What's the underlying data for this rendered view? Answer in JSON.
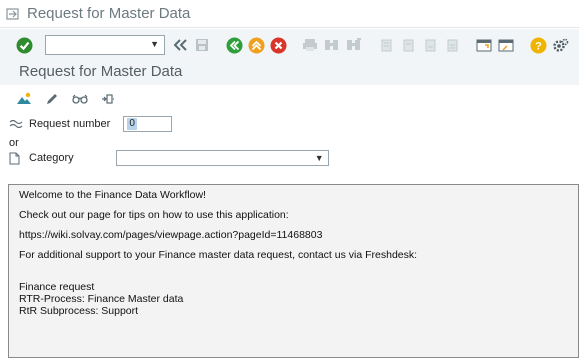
{
  "window": {
    "title": "Request for Master Data"
  },
  "toolbar": {
    "command_field": {
      "value": ""
    },
    "icons": [
      "enter-icon",
      "back-icon",
      "save-icon",
      "back-green-icon",
      "exit-icon",
      "cancel-icon",
      "print-icon",
      "find-icon",
      "find-next-icon",
      "first-page-icon",
      "previous-page-icon",
      "next-page-icon",
      "last-page-icon",
      "create-session-icon",
      "shortcut-icon",
      "help-icon",
      "settings-icon"
    ]
  },
  "app": {
    "title": "Request for Master Data",
    "toolbar_icons": [
      "create-icon",
      "edit-icon",
      "display-icon",
      "execute-icon"
    ]
  },
  "form": {
    "request_number_label": "Request number",
    "request_number_value": "0",
    "or_label": "or",
    "category_label": "Category",
    "category_value": ""
  },
  "message": {
    "lines": [
      "Welcome to the Finance Data Workflow!",
      "Check out our page for tips on how to use this application:",
      "https://wiki.solvay.com/pages/viewpage.action?pageId=11468803",
      "For additional support to your Finance master data request, contact us via Freshdesk:",
      "Finance request",
      "RTR-Process: Finance Master data",
      "RtR Subprocess: Support"
    ]
  },
  "colors": {
    "enter": "#2e8b2e",
    "nav_orange": "#f0a020",
    "nav_green": "#2e9e3a",
    "cancel_red": "#d9352b",
    "help": "#f0b400"
  }
}
